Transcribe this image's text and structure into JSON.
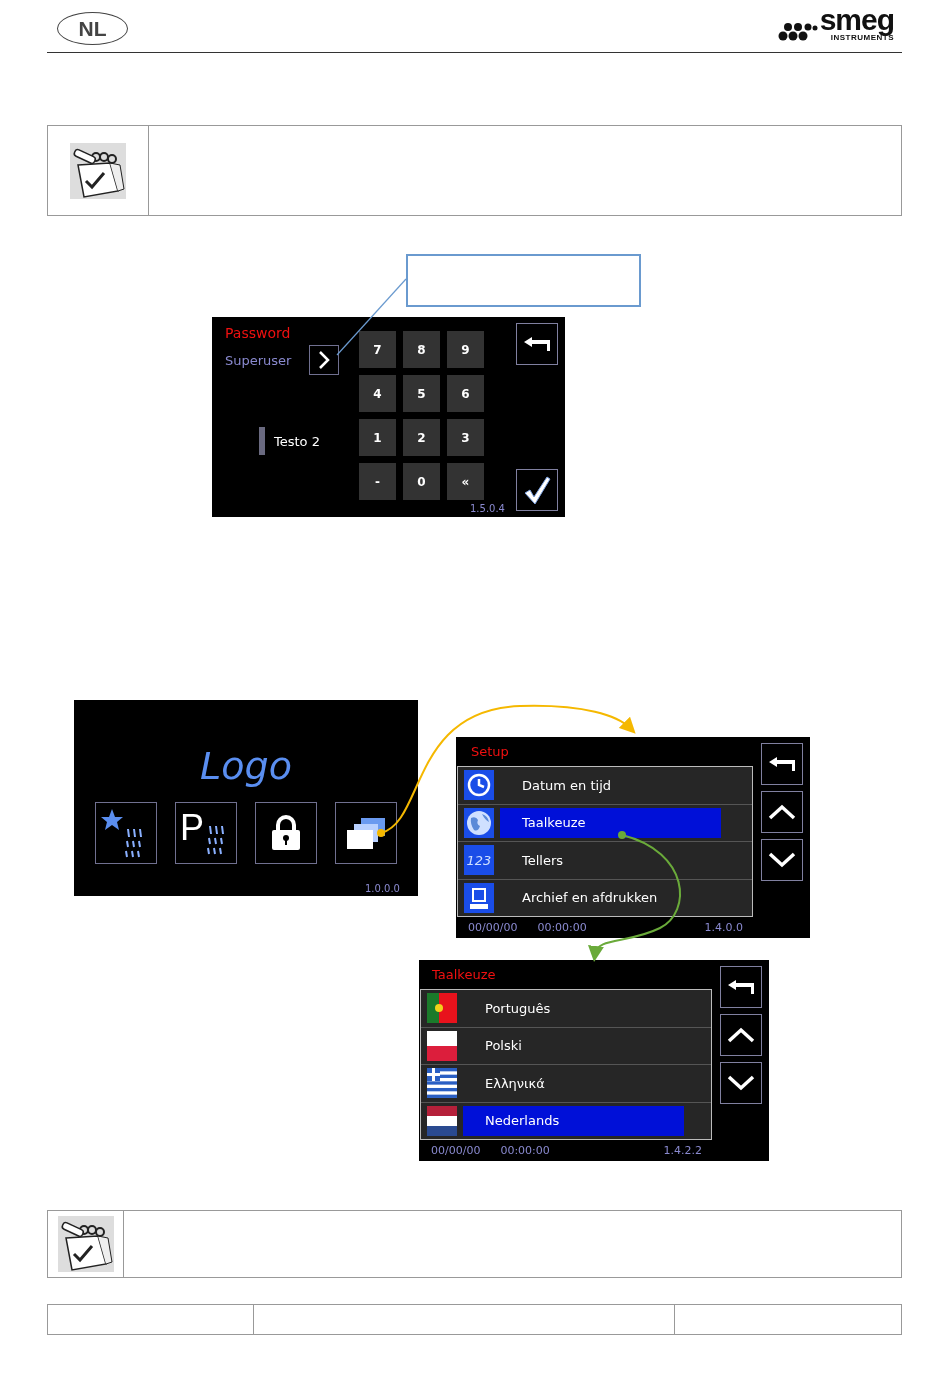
{
  "header": {
    "language_badge": "NL",
    "logo": {
      "wordmark": "smeg",
      "tagline": "INSTRUMENTS"
    }
  },
  "password_screen": {
    "title": "Password",
    "user": "Superuser",
    "keypad": [
      "7",
      "8",
      "9",
      "4",
      "5",
      "6",
      "1",
      "2",
      "3",
      "-",
      "0",
      "«"
    ],
    "field_label": "Testo 2",
    "version": "1.5.0.4"
  },
  "home_screen": {
    "logo": "Logo",
    "buttons": [
      {
        "kind": "star-wash"
      },
      {
        "kind": "program-wash",
        "letter": "P"
      },
      {
        "kind": "lock"
      },
      {
        "kind": "menu"
      }
    ],
    "version": "1.0.0.0"
  },
  "setup_screen": {
    "title": "Setup",
    "items": [
      {
        "label": "Datum en tijd",
        "kind": "clock",
        "selected": false
      },
      {
        "label": "Taalkeuze",
        "kind": "globe",
        "selected": true
      },
      {
        "label": "Tellers",
        "kind": "counter",
        "icon_text": "123",
        "selected": false
      },
      {
        "label": "Archief en afdrukken",
        "kind": "archive",
        "selected": false
      }
    ],
    "date": "00/00/00",
    "time": "00:00:00",
    "version": "1.4.0.0"
  },
  "language_screen": {
    "title": "Taalkeuze",
    "items": [
      {
        "label": "Português",
        "kind": "pt",
        "selected": false
      },
      {
        "label": "Polski",
        "kind": "pl",
        "selected": false
      },
      {
        "label": "Ελληνικά",
        "kind": "gr",
        "selected": false
      },
      {
        "label": "Nederlands",
        "kind": "nl",
        "selected": true
      }
    ],
    "date": "00/00/00",
    "time": "00:00:00",
    "version": "1.4.2.2"
  }
}
